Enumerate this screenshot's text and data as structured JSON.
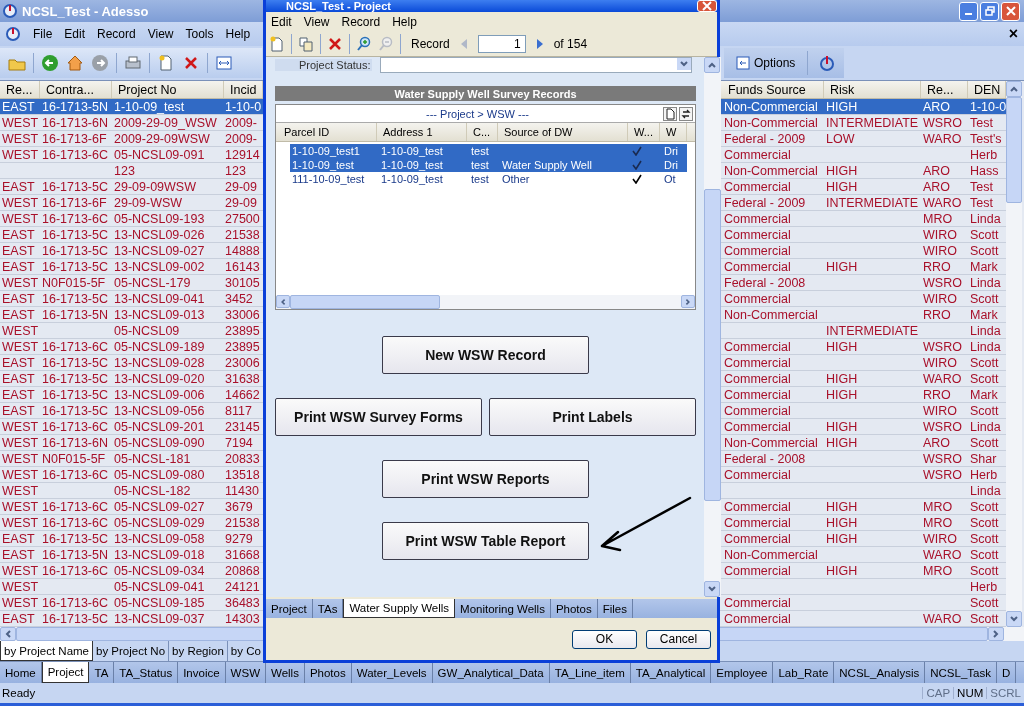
{
  "main_window": {
    "title": "NCSL_Test - Adesso",
    "menu": [
      "File",
      "Edit",
      "Record",
      "View",
      "Tools",
      "Help"
    ],
    "close_mark": "×",
    "options_button": "Options"
  },
  "grid": {
    "columns": [
      "Re...",
      "Contra...",
      "Project No",
      "Incid",
      "Funds Source",
      "Risk",
      "Re...",
      "DEN"
    ],
    "rows": [
      {
        "selected": true,
        "re": "EAST",
        "contra": "16-1713-5N",
        "project_no": "1-10-09_test",
        "incid": "1-10-0",
        "funds_source": "Non-Commercial",
        "risk": "HIGH",
        "re_2": "ARO",
        "den": "1-10-0"
      },
      {
        "selected": false,
        "re": "WEST",
        "contra": "16-1713-6N",
        "project_no": "2009-29-09_WSW",
        "incid": "2009-",
        "funds_source": "Non-Commercial",
        "risk": "INTERMEDIATE",
        "re_2": "WSRO",
        "den": "Test"
      },
      {
        "selected": false,
        "re": "WEST",
        "contra": "16-1713-6F",
        "project_no": "2009-29-09WSW",
        "incid": "2009-",
        "funds_source": "Federal - 2009",
        "risk": "LOW",
        "re_2": "WARO",
        "den": "Test's"
      },
      {
        "selected": false,
        "re": "WEST",
        "contra": "16-1713-6C",
        "project_no": "05-NCSL09-091",
        "incid": "12914",
        "funds_source": "Commercial",
        "den": "Herb"
      },
      {
        "selected": false,
        "project_no": "123",
        "incid": "123",
        "funds_source": "Non-Commercial",
        "risk": "HIGH",
        "re_2": "ARO",
        "den": "Hass"
      },
      {
        "selected": false,
        "re": "EAST",
        "contra": "16-1713-5C",
        "project_no": "29-09-09WSW",
        "incid": "29-09",
        "funds_source": "Commercial",
        "risk": "HIGH",
        "re_2": "ARO",
        "den": "Test"
      },
      {
        "selected": false,
        "re": "WEST",
        "contra": "16-1713-6F",
        "project_no": "29-09-WSW",
        "incid": "29-09",
        "funds_source": "Federal - 2009",
        "risk": "INTERMEDIATE",
        "re_2": "WARO",
        "den": "Test"
      },
      {
        "selected": false,
        "re": "WEST",
        "contra": "16-1713-6C",
        "project_no": "05-NCSL09-193",
        "incid": "27500",
        "funds_source": "Commercial",
        "re_2": "MRO",
        "den": "Linda"
      },
      {
        "selected": false,
        "re": "EAST",
        "contra": "16-1713-5C",
        "project_no": "13-NCSL09-026",
        "incid": "21538",
        "funds_source": "Commercial",
        "re_2": "WIRO",
        "den": "Scott"
      },
      {
        "selected": false,
        "re": "EAST",
        "contra": "16-1713-5C",
        "project_no": "13-NCSL09-027",
        "incid": "14888",
        "funds_source": "Commercial",
        "re_2": "WIRO",
        "den": "Scott"
      },
      {
        "selected": false,
        "re": "EAST",
        "contra": "16-1713-5C",
        "project_no": "13-NCSL09-002",
        "incid": "16143",
        "funds_source": "Commercial",
        "risk": "HIGH",
        "re_2": "RRO",
        "den": "Mark"
      },
      {
        "selected": false,
        "re": "WEST",
        "contra": "N0F015-5F",
        "project_no": "05-NCSL-179",
        "incid": "30105",
        "funds_source": "Federal - 2008",
        "re_2": "WSRO",
        "den": "Linda"
      },
      {
        "selected": false,
        "re": "EAST",
        "contra": "16-1713-5C",
        "project_no": "13-NCSL09-041",
        "incid": "3452",
        "funds_source": "Commercial",
        "re_2": "WIRO",
        "den": "Scott"
      },
      {
        "selected": false,
        "re": "EAST",
        "contra": "16-1713-5N",
        "project_no": "13-NCSL09-013",
        "incid": "33006",
        "funds_source": "Non-Commercial",
        "re_2": "RRO",
        "den": "Mark"
      },
      {
        "selected": false,
        "re": "WEST",
        "project_no": "05-NCSL09",
        "incid": "23895",
        "risk": "INTERMEDIATE",
        "den": "Linda"
      },
      {
        "selected": false,
        "re": "WEST",
        "contra": "16-1713-6C",
        "project_no": "05-NCSL09-189",
        "incid": "23895",
        "funds_source": "Commercial",
        "risk": "HIGH",
        "re_2": "WSRO",
        "den": "Linda"
      },
      {
        "selected": false,
        "re": "EAST",
        "contra": "16-1713-5C",
        "project_no": "13-NCSL09-028",
        "incid": "23006",
        "funds_source": "Commercial",
        "re_2": "WIRO",
        "den": "Scott"
      },
      {
        "selected": false,
        "re": "EAST",
        "contra": "16-1713-5C",
        "project_no": "13-NCSL09-020",
        "incid": "31638",
        "funds_source": "Commercial",
        "risk": "HIGH",
        "re_2": "WARO",
        "den": "Scott"
      },
      {
        "selected": false,
        "re": "EAST",
        "contra": "16-1713-5C",
        "project_no": "13-NCSL09-006",
        "incid": "14662",
        "funds_source": "Commercial",
        "risk": "HIGH",
        "re_2": "RRO",
        "den": "Mark"
      },
      {
        "selected": false,
        "re": "EAST",
        "contra": "16-1713-5C",
        "project_no": "13-NCSL09-056",
        "incid": "8117",
        "funds_source": "Commercial",
        "re_2": "WIRO",
        "den": "Scott"
      },
      {
        "selected": false,
        "re": "WEST",
        "contra": "16-1713-6C",
        "project_no": "05-NCSL09-201",
        "incid": "23145",
        "funds_source": "Commercial",
        "risk": "HIGH",
        "re_2": "WSRO",
        "den": "Linda"
      },
      {
        "selected": false,
        "re": "WEST",
        "contra": "16-1713-6N",
        "project_no": "05-NCSL09-090",
        "incid": "7194",
        "funds_source": "Non-Commercial",
        "risk": "HIGH",
        "re_2": "ARO",
        "den": "Scott"
      },
      {
        "selected": false,
        "re": "WEST",
        "contra": "N0F015-5F",
        "project_no": "05-NCSL-181",
        "incid": "20833",
        "funds_source": "Federal - 2008",
        "re_2": "WSRO",
        "den": "Shar"
      },
      {
        "selected": false,
        "re": "WEST",
        "contra": "16-1713-6C",
        "project_no": "05-NCSL09-080",
        "incid": "13518",
        "funds_source": "Commercial",
        "re_2": "WSRO",
        "den": "Herb"
      },
      {
        "selected": false,
        "re": "WEST",
        "project_no": "05-NCSL-182",
        "incid": "11430",
        "den": "Linda"
      },
      {
        "selected": false,
        "re": "WEST",
        "contra": "16-1713-6C",
        "project_no": "05-NCSL09-027",
        "incid": "3679",
        "funds_source": "Commercial",
        "risk": "HIGH",
        "re_2": "MRO",
        "den": "Scott"
      },
      {
        "selected": false,
        "re": "WEST",
        "contra": "16-1713-6C",
        "project_no": "05-NCSL09-029",
        "incid": "21538",
        "funds_source": "Commercial",
        "risk": "HIGH",
        "re_2": "MRO",
        "den": "Scott"
      },
      {
        "selected": false,
        "re": "EAST",
        "contra": "16-1713-5C",
        "project_no": "13-NCSL09-058",
        "incid": "9279",
        "funds_source": "Commercial",
        "risk": "HIGH",
        "re_2": "WIRO",
        "den": "Scott"
      },
      {
        "selected": false,
        "re": "EAST",
        "contra": "16-1713-5N",
        "project_no": "13-NCSL09-018",
        "incid": "31668",
        "funds_source": "Non-Commercial",
        "re_2": "WARO",
        "den": "Scott"
      },
      {
        "selected": false,
        "re": "WEST",
        "contra": "16-1713-6C",
        "project_no": "05-NCSL09-034",
        "incid": "20868",
        "funds_source": "Commercial",
        "risk": "HIGH",
        "re_2": "MRO",
        "den": "Scott"
      },
      {
        "selected": false,
        "re": "WEST",
        "project_no": "05-NCSL09-041",
        "incid": "24121",
        "den": "Herb"
      },
      {
        "selected": false,
        "re": "WEST",
        "contra": "16-1713-6C",
        "project_no": "05-NCSL09-185",
        "incid": "36483",
        "funds_source": "Commercial",
        "den": "Scott"
      },
      {
        "selected": false,
        "re": "EAST",
        "contra": "16-1713-5C",
        "project_no": "13-NCSL09-037",
        "incid": "14303",
        "funds_source": "Commercial",
        "re_2": "WARO",
        "den": "Scott"
      }
    ]
  },
  "sort_tabs": [
    {
      "label": "by Project Name",
      "selected": true
    },
    {
      "label": "by Project No",
      "selected": false
    },
    {
      "label": "by Region",
      "selected": false
    },
    {
      "label": "by Co",
      "selected": false
    }
  ],
  "module_tabs": [
    {
      "label": "Home",
      "selected": false
    },
    {
      "label": "Project",
      "selected": true
    },
    {
      "label": "TA",
      "selected": false
    },
    {
      "label": "TA_Status",
      "selected": false
    },
    {
      "label": "Invoice",
      "selected": false
    },
    {
      "label": "WSW",
      "selected": false
    },
    {
      "label": "Wells",
      "selected": false
    },
    {
      "label": "Photos",
      "selected": false
    },
    {
      "label": "Water_Levels",
      "selected": false
    },
    {
      "label": "GW_Analytical_Data",
      "selected": false
    },
    {
      "label": "TA_Line_item",
      "selected": false
    },
    {
      "label": "TA_Analytical",
      "selected": false
    },
    {
      "label": "Employee",
      "selected": false
    },
    {
      "label": "Lab_Rate",
      "selected": false
    },
    {
      "label": "NCSL_Analysis",
      "selected": false
    },
    {
      "label": "NCSL_Task",
      "selected": false
    },
    {
      "label": "D",
      "selected": false
    }
  ],
  "status_bar": {
    "text": "Ready",
    "indicators": [
      {
        "label": "CAP",
        "on": false
      },
      {
        "label": "NUM",
        "on": true
      },
      {
        "label": "SCRL",
        "on": false
      }
    ]
  },
  "dialog": {
    "title": "NCSL_Test - Project",
    "menu": [
      "Edit",
      "View",
      "Record",
      "Help"
    ],
    "record_label": "Record",
    "record_number": "1",
    "record_total": "of 154",
    "status_label": "Project Status:",
    "section_title": "Water Supply Well Survey Records",
    "subform_title": "---  Project > WSW  ---",
    "subform_columns": [
      "Parcel ID",
      "Address 1",
      "C...",
      "Source of DW",
      "W...",
      "W"
    ],
    "subform_rows": [
      {
        "selected": true,
        "parcel_id": "1-10-09_test1",
        "address_1": "1-10-09_test",
        "c": "test",
        "checked": true,
        "w": "Dri"
      },
      {
        "selected": true,
        "parcel_id": "1-10-09_test",
        "address_1": "1-10-09_test",
        "c": "test",
        "source_of_dw": "Water Supply Well",
        "checked": true,
        "w": "Dri"
      },
      {
        "selected": false,
        "parcel_id": "111-10-09_test",
        "address_1": "1-10-09_test",
        "c": "test",
        "source_of_dw": "Other",
        "checked": true,
        "w": "Ot"
      }
    ],
    "button_rows": [
      [
        "New WSW Record"
      ],
      [
        "Print WSW Survey Forms",
        "Print Labels"
      ],
      [
        "Print WSW Reports"
      ],
      [
        "Print WSW Table Report"
      ]
    ],
    "tabs": [
      {
        "label": "Project",
        "selected": false
      },
      {
        "label": "TAs",
        "selected": false
      },
      {
        "label": "Water Supply Wells",
        "selected": true
      },
      {
        "label": "Monitoring Wells",
        "selected": false
      },
      {
        "label": "Photos",
        "selected": false
      },
      {
        "label": "Files",
        "selected": false
      }
    ],
    "ok": "OK",
    "cancel": "Cancel"
  }
}
